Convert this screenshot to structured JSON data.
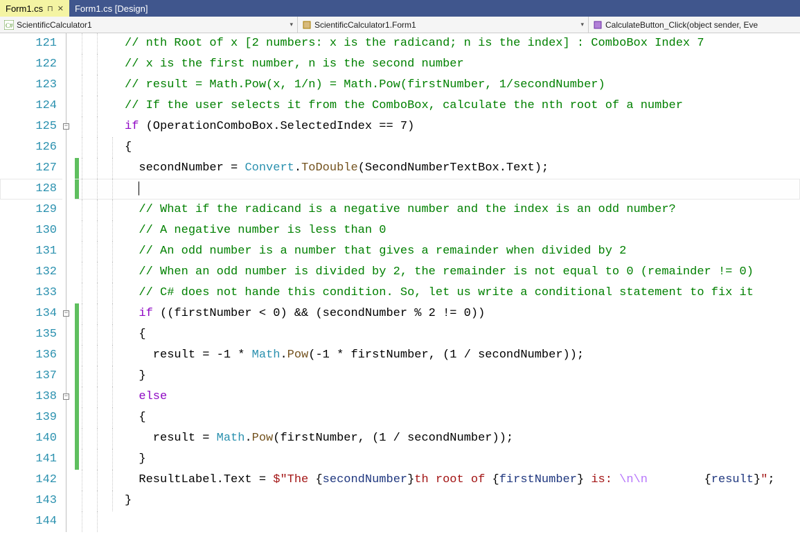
{
  "tabs": [
    {
      "label": "Form1.cs",
      "active": true,
      "pinned": true
    },
    {
      "label": "Form1.cs [Design]",
      "active": false,
      "pinned": false
    }
  ],
  "nav": {
    "project": "ScientificCalculator1",
    "class": "ScientificCalculator1.Form1",
    "member": "CalculateButton_Click(object sender, Eve"
  },
  "lines": [
    {
      "n": 121,
      "ind": 2,
      "seg": [
        [
          "c-comment",
          "// nth Root of x [2 numbers: x is the radicand; n is the index] : ComboBox Index 7"
        ]
      ]
    },
    {
      "n": 122,
      "ind": 2,
      "seg": [
        [
          "c-comment",
          "// x is the first number, n is the second number"
        ]
      ]
    },
    {
      "n": 123,
      "ind": 2,
      "seg": [
        [
          "c-comment",
          "// result = Math.Pow(x, 1/n) = Math.Pow(firstNumber, 1/secondNumber)"
        ]
      ]
    },
    {
      "n": 124,
      "ind": 2,
      "seg": [
        [
          "c-comment",
          "// If the user selects it from the ComboBox, calculate the nth root of a number"
        ]
      ]
    },
    {
      "n": 125,
      "ind": 2,
      "box": "-",
      "seg": [
        [
          "c-purple",
          "if"
        ],
        [
          "",
          " (OperationComboBox.SelectedIndex == 7)"
        ]
      ]
    },
    {
      "n": 126,
      "ind": 3,
      "seg": [
        [
          "",
          "{"
        ]
      ]
    },
    {
      "n": 127,
      "ind": 3,
      "mod": true,
      "seg": [
        [
          "",
          "  secondNumber = "
        ],
        [
          "c-type",
          "Convert"
        ],
        [
          "",
          "."
        ],
        [
          "c-member",
          "ToDouble"
        ],
        [
          "",
          "(SecondNumberTextBox.Text);"
        ]
      ]
    },
    {
      "n": 128,
      "ind": 3,
      "mod": true,
      "current": true,
      "seg": [
        [
          "",
          "  "
        ]
      ]
    },
    {
      "n": 129,
      "ind": 3,
      "seg": [
        [
          "",
          "  "
        ],
        [
          "c-comment",
          "// What if the radicand is a negative number and the index is an odd number?"
        ]
      ]
    },
    {
      "n": 130,
      "ind": 3,
      "seg": [
        [
          "",
          "  "
        ],
        [
          "c-comment",
          "// A negative number is less than 0"
        ]
      ]
    },
    {
      "n": 131,
      "ind": 3,
      "seg": [
        [
          "",
          "  "
        ],
        [
          "c-comment",
          "// An odd number is a number that gives a remainder when divided by 2"
        ]
      ]
    },
    {
      "n": 132,
      "ind": 3,
      "seg": [
        [
          "",
          "  "
        ],
        [
          "c-comment",
          "// When an odd number is divided by 2, the remainder is not equal to 0 (remainder != 0)"
        ]
      ]
    },
    {
      "n": 133,
      "ind": 3,
      "seg": [
        [
          "",
          "  "
        ],
        [
          "c-comment",
          "// C# does not hande this condition. So, let us write a conditional statement to fix it"
        ]
      ]
    },
    {
      "n": 134,
      "ind": 3,
      "box": "-",
      "mod": true,
      "seg": [
        [
          "",
          "  "
        ],
        [
          "c-purple",
          "if"
        ],
        [
          "",
          " ((firstNumber < 0) && (secondNumber % 2 != 0))"
        ]
      ]
    },
    {
      "n": 135,
      "ind": 4,
      "mod": true,
      "seg": [
        [
          "",
          "  {"
        ]
      ]
    },
    {
      "n": 136,
      "ind": 4,
      "mod": true,
      "seg": [
        [
          "",
          "    result = -1 * "
        ],
        [
          "c-type",
          "Math"
        ],
        [
          "",
          "."
        ],
        [
          "c-member",
          "Pow"
        ],
        [
          "",
          "(-1 * firstNumber, (1 / secondNumber));"
        ]
      ]
    },
    {
      "n": 137,
      "ind": 4,
      "mod": true,
      "seg": [
        [
          "",
          "  }"
        ]
      ]
    },
    {
      "n": 138,
      "ind": 3,
      "box": "-",
      "mod": true,
      "seg": [
        [
          "",
          "  "
        ],
        [
          "c-purple",
          "else"
        ]
      ]
    },
    {
      "n": 139,
      "ind": 4,
      "mod": true,
      "seg": [
        [
          "",
          "  {"
        ]
      ]
    },
    {
      "n": 140,
      "ind": 4,
      "mod": true,
      "seg": [
        [
          "",
          "    result = "
        ],
        [
          "c-type",
          "Math"
        ],
        [
          "",
          "."
        ],
        [
          "c-member",
          "Pow"
        ],
        [
          "",
          "(firstNumber, (1 / secondNumber));"
        ]
      ]
    },
    {
      "n": 141,
      "ind": 4,
      "mod": true,
      "seg": [
        [
          "",
          "  }"
        ]
      ]
    },
    {
      "n": 142,
      "ind": 3,
      "seg": [
        [
          "",
          "  ResultLabel.Text = "
        ],
        [
          "c-string",
          "$\"The "
        ],
        [
          "",
          "{"
        ],
        [
          "c-ident",
          "secondNumber"
        ],
        [
          "",
          "}"
        ],
        [
          "c-string",
          "th root of "
        ],
        [
          "",
          "{"
        ],
        [
          "c-ident",
          "firstNumber"
        ],
        [
          "",
          "}"
        ],
        [
          "c-string",
          " is: "
        ],
        [
          "c-escape",
          "\\n\\n"
        ],
        [
          "c-string",
          "        "
        ],
        [
          "",
          "{"
        ],
        [
          "c-ident",
          "result"
        ],
        [
          "",
          "}"
        ],
        [
          "c-string",
          "\""
        ],
        [
          "",
          ";"
        ]
      ]
    },
    {
      "n": 143,
      "ind": 3,
      "seg": [
        [
          "",
          "}"
        ]
      ]
    },
    {
      "n": 144,
      "ind": 2,
      "seg": [
        [
          "",
          ""
        ]
      ]
    }
  ]
}
